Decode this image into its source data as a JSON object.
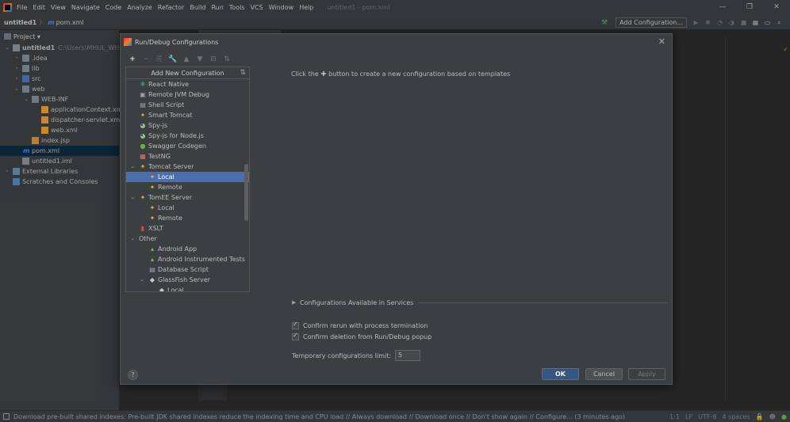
{
  "menubar": {
    "items": [
      "File",
      "Edit",
      "View",
      "Navigate",
      "Code",
      "Analyze",
      "Refactor",
      "Build",
      "Run",
      "Tools",
      "VCS",
      "Window",
      "Help"
    ],
    "title": "untitled1 - pom.xml",
    "window_controls": [
      "—",
      "❐",
      "✕"
    ]
  },
  "navbar": {
    "project": "untitled1",
    "separator": "〉",
    "file_icon": "m",
    "file": "pom.xml",
    "run_config": "Add Configuration..."
  },
  "project_panel": {
    "title": "Project ▾",
    "tree": [
      {
        "label": "untitled1",
        "suffix": "C:\\Users\\MHUL_WHITE\\",
        "depth": 0,
        "expanded": true,
        "icon": "module-folder",
        "bold": true
      },
      {
        "label": ".idea",
        "depth": 1,
        "expanded": false,
        "icon": "folder"
      },
      {
        "label": "lib",
        "depth": 1,
        "expanded": false,
        "icon": "folder"
      },
      {
        "label": "src",
        "depth": 1,
        "expanded": false,
        "icon": "source-folder"
      },
      {
        "label": "web",
        "depth": 1,
        "expanded": true,
        "icon": "folder"
      },
      {
        "label": "WEB-INF",
        "depth": 2,
        "expanded": true,
        "icon": "folder"
      },
      {
        "label": "applicationContext.xml",
        "depth": 3,
        "icon": "xml-file"
      },
      {
        "label": "dispatcher-servlet.xml",
        "depth": 3,
        "icon": "xml-file"
      },
      {
        "label": "web.xml",
        "depth": 3,
        "icon": "xml-file"
      },
      {
        "label": "index.jsp",
        "depth": 2,
        "icon": "jsp-file"
      },
      {
        "label": "pom.xml",
        "depth": 1,
        "icon": "maven-file",
        "selected": true
      },
      {
        "label": "untitled1.iml",
        "depth": 1,
        "icon": "iml-file"
      },
      {
        "label": "External Libraries",
        "depth": 0,
        "expanded": false,
        "icon": "library"
      },
      {
        "label": "Scratches and Consoles",
        "depth": 0,
        "icon": "scratch"
      }
    ]
  },
  "dialog": {
    "title": "Run/Debug Configurations",
    "close": "✕",
    "toolbar": [
      "+",
      "−",
      "⎘",
      "🔧",
      "▲",
      "▼",
      "⊟",
      "⇅"
    ],
    "add_header": "Add New Configuration",
    "config_list": [
      {
        "label": "React Native",
        "depth": 0,
        "icon": "react-native-icon",
        "glyph": "⚛",
        "color": "#61dafb"
      },
      {
        "label": "Remote JVM Debug",
        "depth": 0,
        "icon": "remote-debug-icon",
        "glyph": "▣",
        "color": "#9aa7b0"
      },
      {
        "label": "Shell Script",
        "depth": 0,
        "icon": "shell-script-icon",
        "glyph": "▤",
        "color": "#9aa7b0"
      },
      {
        "label": "Smart Tomcat",
        "depth": 0,
        "icon": "smart-tomcat-icon",
        "glyph": "✦",
        "color": "#e5b13a"
      },
      {
        "label": "Spy-js",
        "depth": 0,
        "icon": "spyjs-icon",
        "glyph": "◕",
        "color": "#8fc08b"
      },
      {
        "label": "Spy-js for Node.js",
        "depth": 0,
        "icon": "spyjs-node-icon",
        "glyph": "◕",
        "color": "#8fc08b"
      },
      {
        "label": "Swagger Codegen",
        "depth": 0,
        "icon": "swagger-icon",
        "glyph": "●",
        "color": "#62b543"
      },
      {
        "label": "TestNG",
        "depth": 0,
        "icon": "testng-icon",
        "glyph": "▦",
        "color": "#d97b5a"
      },
      {
        "label": "Tomcat Server",
        "depth": 0,
        "expanded": true,
        "icon": "tomcat-icon",
        "glyph": "✦",
        "color": "#e5b13a"
      },
      {
        "label": "Local",
        "depth": 1,
        "icon": "tomcat-local-icon",
        "glyph": "✦",
        "color": "#e5b13a",
        "selected": true
      },
      {
        "label": "Remote",
        "depth": 1,
        "icon": "tomcat-remote-icon",
        "glyph": "✦",
        "color": "#e5b13a"
      },
      {
        "label": "TomEE Server",
        "depth": 0,
        "expanded": true,
        "icon": "tomee-icon",
        "glyph": "✦",
        "color": "#e5b13a"
      },
      {
        "label": "Local",
        "depth": 1,
        "icon": "tomee-local-icon",
        "glyph": "✦",
        "color": "#e5b13a"
      },
      {
        "label": "Remote",
        "depth": 1,
        "icon": "tomee-remote-icon",
        "glyph": "✦",
        "color": "#e5b13a"
      },
      {
        "label": "XSLT",
        "depth": 0,
        "icon": "xslt-icon",
        "glyph": "▮",
        "color": "#c75450"
      },
      {
        "label": "Other",
        "depth": 0,
        "expanded": true,
        "icon": "",
        "glyph": "",
        "color": ""
      },
      {
        "label": "Android App",
        "depth": 1,
        "icon": "android-icon",
        "glyph": "▴",
        "color": "#78c257"
      },
      {
        "label": "Android Instrumented Tests",
        "depth": 1,
        "icon": "android-tests-icon",
        "glyph": "▴",
        "color": "#78c257"
      },
      {
        "label": "Database Script",
        "depth": 1,
        "icon": "database-icon",
        "glyph": "▤",
        "color": "#9aa7b0"
      },
      {
        "label": "GlassFish Server",
        "depth": 1,
        "expanded": true,
        "icon": "glassfish-icon",
        "glyph": "◆",
        "color": "#c8c8c8"
      },
      {
        "label": "Local",
        "depth": 2,
        "icon": "glassfish-local-icon",
        "glyph": "◆",
        "color": "#c8c8c8"
      }
    ],
    "hint_before": "Click the",
    "hint_plus": "+",
    "hint_after": "button to create a new configuration based on templates",
    "services_label": "Configurations Available in Services",
    "confirm_rerun": "Confirm rerun with process termination",
    "confirm_delete": "Confirm deletion from Run/Debug popup",
    "limit_label": "Temporary configurations limit:",
    "limit_value": "5",
    "help": "?",
    "ok": "OK",
    "cancel": "Cancel",
    "apply": "Apply"
  },
  "statusbar": {
    "message": "Download pre-built shared indexes: Pre-built JDK shared indexes reduce the indexing time and CPU load // Always download // Download once // Don't show again // Configure... (3 minutes ago)",
    "position": "1:1",
    "line_sep": "LF",
    "encoding": "UTF-8",
    "indent": "4 spaces"
  },
  "colors": {
    "accent_selection": "#4b6eaf",
    "ok_button": "#365880",
    "panel_bg": "#3c3f41",
    "editor_bg": "#2b2b2b"
  }
}
